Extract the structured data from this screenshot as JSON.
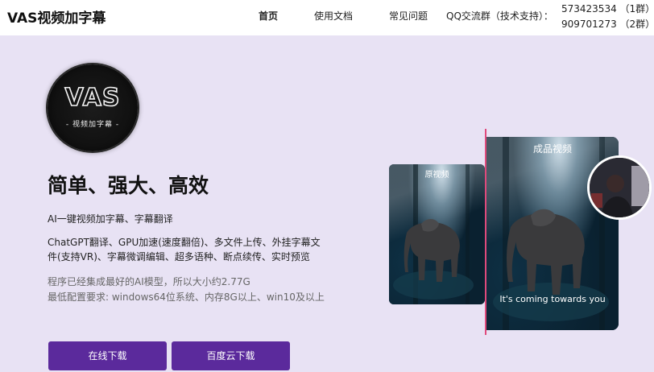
{
  "header": {
    "brand": "VAS视频加字幕",
    "nav": [
      {
        "label": "首页"
      },
      {
        "label": "使用文档"
      },
      {
        "label": "常见问题"
      }
    ],
    "qq_label": "QQ交流群（技术支持）：",
    "qq_groups": [
      {
        "label": "573423534 （1群）"
      },
      {
        "label": "909701273 （2群）"
      }
    ]
  },
  "logo": {
    "text": "VAS",
    "subtext": "- 视频加字幕 -"
  },
  "hero": {
    "title": "简单、强大、高效",
    "line1": "AI一键视频加字幕、字幕翻译",
    "features": "ChatGPT翻译、GPU加速(速度翻倍)、多文件上传、外挂字幕文件(支持VR)、字幕微调编辑、超多语种、断点续传、实时预览",
    "note1": "程序已经集成最好的AI模型，所以大小约2.77G",
    "note2": "最低配置要求: windows64位系统、内存8G以上、win10及以上"
  },
  "buttons": {
    "online_download": "在线下载",
    "baidu_download": "百度云下载"
  },
  "preview": {
    "original_label": "原视频",
    "final_label": "成品视频",
    "subtitle": "It's coming towards you"
  },
  "colors": {
    "background": "#e8e2f4",
    "button": "#5b2a9c",
    "divider": "#e04a7c"
  }
}
